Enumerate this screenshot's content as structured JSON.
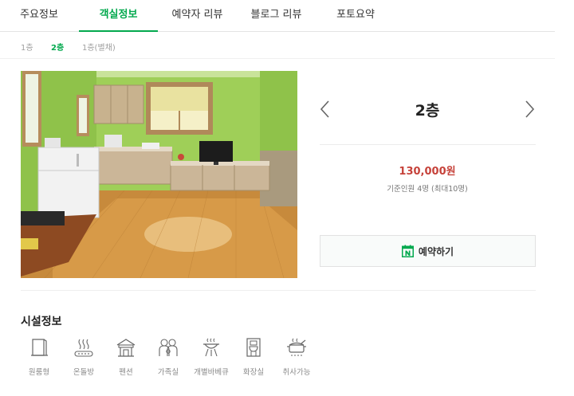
{
  "tabs": [
    {
      "label": "주요정보",
      "active": false
    },
    {
      "label": "객실정보",
      "active": true
    },
    {
      "label": "예약자 리뷰",
      "active": false
    },
    {
      "label": "블로그 리뷰",
      "active": false
    },
    {
      "label": "포토요약",
      "active": false
    }
  ],
  "floors": [
    {
      "label": "1층",
      "active": false
    },
    {
      "label": "2층",
      "active": true
    },
    {
      "label": "1층(별채)",
      "active": false
    }
  ],
  "room": {
    "name": "2층",
    "price": "130,000원",
    "capacity": "기준인원 4명 (최대10명)",
    "photo_icon": "room-photo"
  },
  "reserve": {
    "label": "예약하기",
    "icon": "naver-calendar-icon",
    "accent": "#03a94e"
  },
  "facilities": {
    "title": "시설정보",
    "items": [
      {
        "label": "원룸형",
        "icon": "door-icon"
      },
      {
        "label": "온돌방",
        "icon": "ondol-icon"
      },
      {
        "label": "펜션",
        "icon": "pension-icon"
      },
      {
        "label": "가족실",
        "icon": "family-icon"
      },
      {
        "label": "개별바베큐",
        "icon": "bbq-icon"
      },
      {
        "label": "화장실",
        "icon": "toilet-icon"
      },
      {
        "label": "취사가능",
        "icon": "cooking-icon"
      }
    ]
  },
  "colors": {
    "accent": "#03a94e",
    "price": "#c6423a"
  }
}
